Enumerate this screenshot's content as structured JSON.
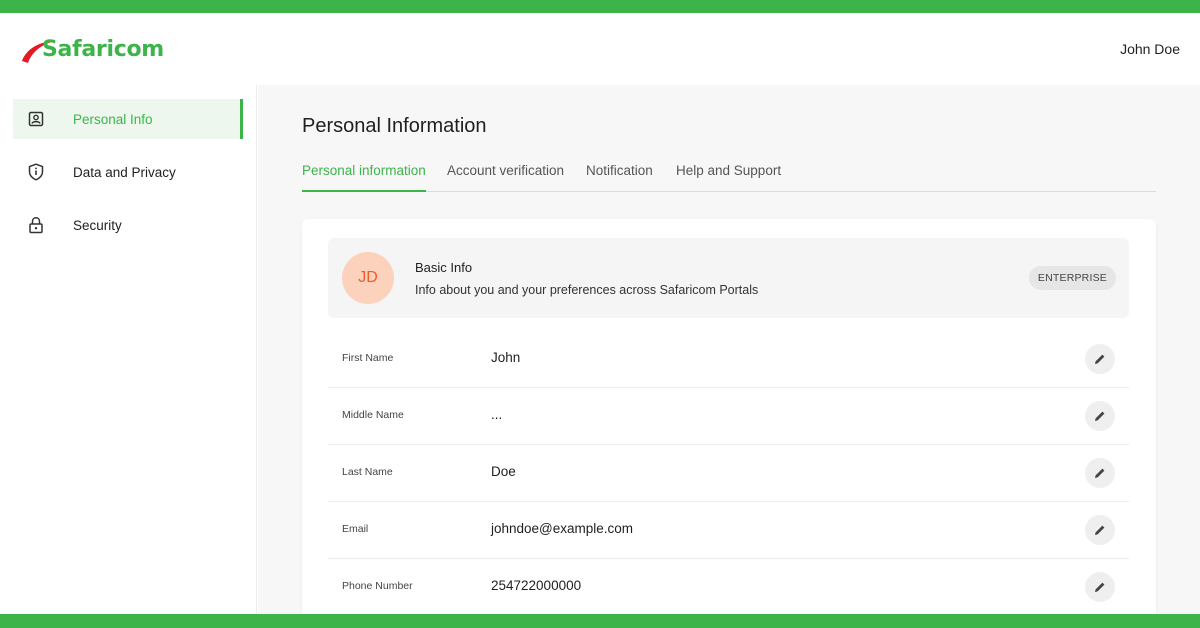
{
  "brand": {
    "logo_text": "Safaricom",
    "accent": "#3cb44a",
    "logo_swoosh": "#e31b23"
  },
  "header": {
    "user_name": "John Doe"
  },
  "sidebar": {
    "items": [
      {
        "label": "Personal Info",
        "icon": "id-card-icon",
        "active": true
      },
      {
        "label": "Data and Privacy",
        "icon": "shield-icon",
        "active": false
      },
      {
        "label": "Security",
        "icon": "lock-icon",
        "active": false
      }
    ]
  },
  "main": {
    "title": "Personal Information",
    "tabs": [
      {
        "label": "Personal information",
        "active": true
      },
      {
        "label": "Account verification",
        "active": false
      },
      {
        "label": "Notification",
        "active": false
      },
      {
        "label": "Help and Support",
        "active": false
      }
    ],
    "basic_info": {
      "initials": "JD",
      "title": "Basic Info",
      "subtitle": "Info about you and your preferences across Safaricom Portals",
      "badge": "ENTERPRISE"
    },
    "fields": [
      {
        "label": "First Name",
        "value": "John"
      },
      {
        "label": "Middle Name",
        "value": "..."
      },
      {
        "label": "Last Name",
        "value": "Doe"
      },
      {
        "label": "Email",
        "value": "johndoe@example.com"
      },
      {
        "label": "Phone Number",
        "value": "254722000000"
      }
    ]
  }
}
